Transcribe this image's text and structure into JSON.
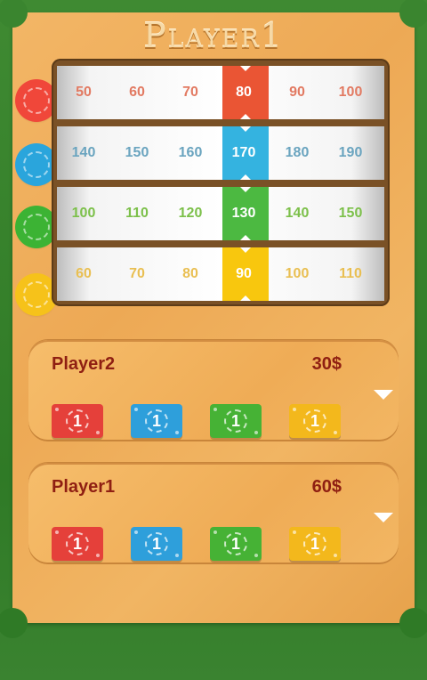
{
  "title": "Player1",
  "reels": [
    {
      "color": "#f0473a",
      "text_color": "#e27a62",
      "highlight": "#ea5534",
      "values": [
        "50",
        "60",
        "70",
        "80",
        "90",
        "100"
      ],
      "selected_index": 3
    },
    {
      "color": "#2aa5dc",
      "text_color": "#6aa4bf",
      "highlight": "#34b3e0",
      "values": [
        "140",
        "150",
        "160",
        "170",
        "180",
        "190"
      ],
      "selected_index": 3
    },
    {
      "color": "#3cb334",
      "text_color": "#7cc04a",
      "highlight": "#4cb941",
      "values": [
        "100",
        "110",
        "120",
        "130",
        "140",
        "150"
      ],
      "selected_index": 3
    },
    {
      "color": "#f6c21a",
      "text_color": "#e9bf52",
      "highlight": "#f8c70e",
      "values": [
        "60",
        "70",
        "80",
        "90",
        "100",
        "110"
      ],
      "selected_index": 3
    }
  ],
  "players": [
    {
      "name": "Player2",
      "money": "30$",
      "notes": [
        {
          "color": "#e5403a",
          "value": "1"
        },
        {
          "color": "#2e9fdb",
          "value": "1"
        },
        {
          "color": "#46b235",
          "value": "1"
        },
        {
          "color": "#f3b81c",
          "value": "1"
        }
      ]
    },
    {
      "name": "Player1",
      "money": "60$",
      "notes": [
        {
          "color": "#e5403a",
          "value": "1"
        },
        {
          "color": "#2e9fdb",
          "value": "1"
        },
        {
          "color": "#46b235",
          "value": "1"
        },
        {
          "color": "#f3b81c",
          "value": "1"
        }
      ]
    }
  ]
}
